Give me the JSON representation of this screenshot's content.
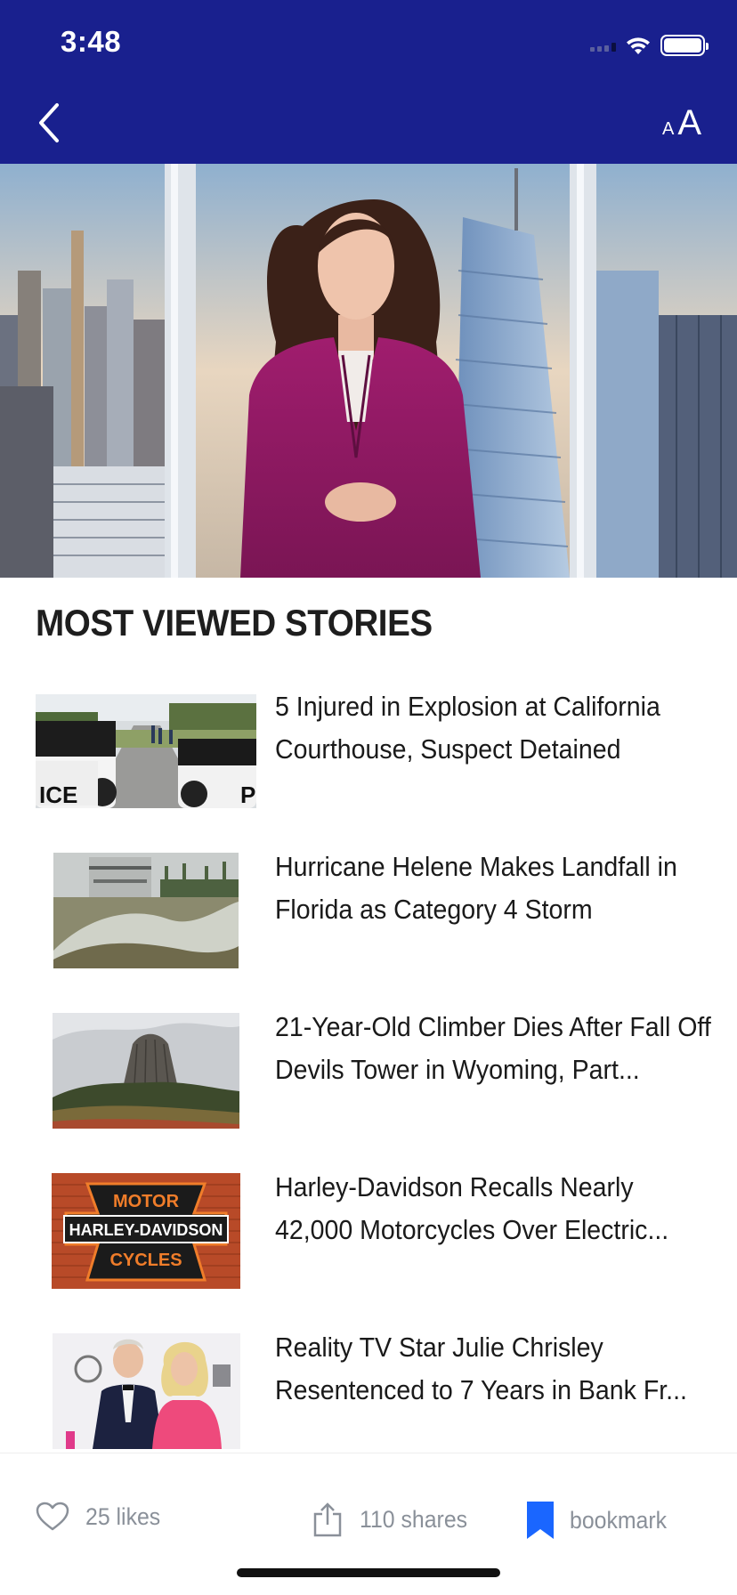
{
  "status_bar": {
    "time": "3:48"
  },
  "header": {
    "text_size_small": "A",
    "text_size_large": "A"
  },
  "section": {
    "title": "MOST VIEWED STORIES"
  },
  "stories": [
    {
      "headline": "5 Injured in Explosion at California Courthouse, Suspect Detained"
    },
    {
      "headline": "Hurricane Helene Makes Landfall in Florida as Category 4 Storm"
    },
    {
      "headline": "21-Year-Old Climber Dies After Fall Off Devils Tower in Wyoming, Part..."
    },
    {
      "headline": "Harley-Davidson Recalls Nearly 42,000 Motorcycles Over Electric..."
    },
    {
      "headline": "Reality TV Star Julie Chrisley Resentenced to 7 Years in Bank Fr..."
    }
  ],
  "thumbs": {
    "police_car_left": "ICE",
    "police_car_right": "P",
    "harley_top": "MOTOR",
    "harley_middle": "HARLEY-DAVIDSON",
    "harley_bottom": "CYCLES"
  },
  "actions": {
    "likes": "25 likes",
    "shares": "110 shares",
    "bookmark": "bookmark"
  },
  "colors": {
    "header": "#19208e",
    "bookmark": "#1a66ff",
    "action_text": "#8a9099"
  }
}
